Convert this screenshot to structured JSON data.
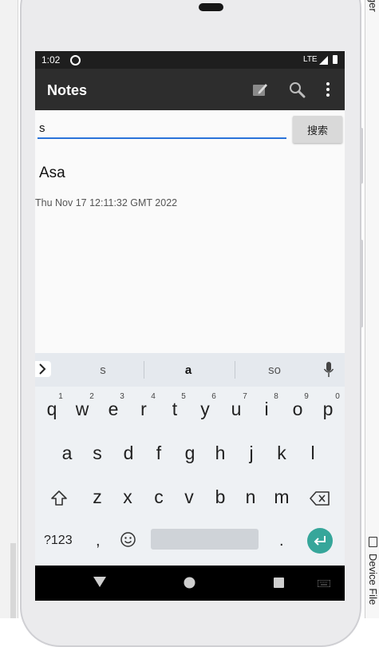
{
  "ide": {
    "right_top_text": "ger",
    "right_bottom_text": "Device File"
  },
  "statusbar": {
    "time": "1:02",
    "network": "LTE"
  },
  "appbar": {
    "title": "Notes"
  },
  "search": {
    "value": "s",
    "button_label": "搜索"
  },
  "notes": [
    {
      "title": "Asa",
      "date": "Thu Nov 17 12:11:32 GMT 2022"
    }
  ],
  "keyboard": {
    "suggestions": [
      "s",
      "a",
      "so"
    ],
    "row1": [
      "q",
      "w",
      "e",
      "r",
      "t",
      "y",
      "u",
      "i",
      "o",
      "p"
    ],
    "row1_hints": [
      "1",
      "2",
      "3",
      "4",
      "5",
      "6",
      "7",
      "8",
      "9",
      "0"
    ],
    "row2": [
      "a",
      "s",
      "d",
      "f",
      "g",
      "h",
      "j",
      "k",
      "l"
    ],
    "row3": [
      "z",
      "x",
      "c",
      "v",
      "b",
      "n",
      "m"
    ],
    "symbols_label": "?123",
    "comma": ",",
    "period": "."
  },
  "colors": {
    "appbar": "#2d2d2d",
    "accent": "#2a73d9",
    "enter_key": "#36a69a"
  },
  "icons": [
    "edit-note-icon",
    "search-icon",
    "more-vert-icon",
    "shift-icon",
    "backspace-icon",
    "emoji-icon",
    "mic-icon",
    "enter-icon",
    "back-nav-icon",
    "home-nav-icon",
    "recents-nav-icon",
    "keyboard-switch-icon"
  ]
}
